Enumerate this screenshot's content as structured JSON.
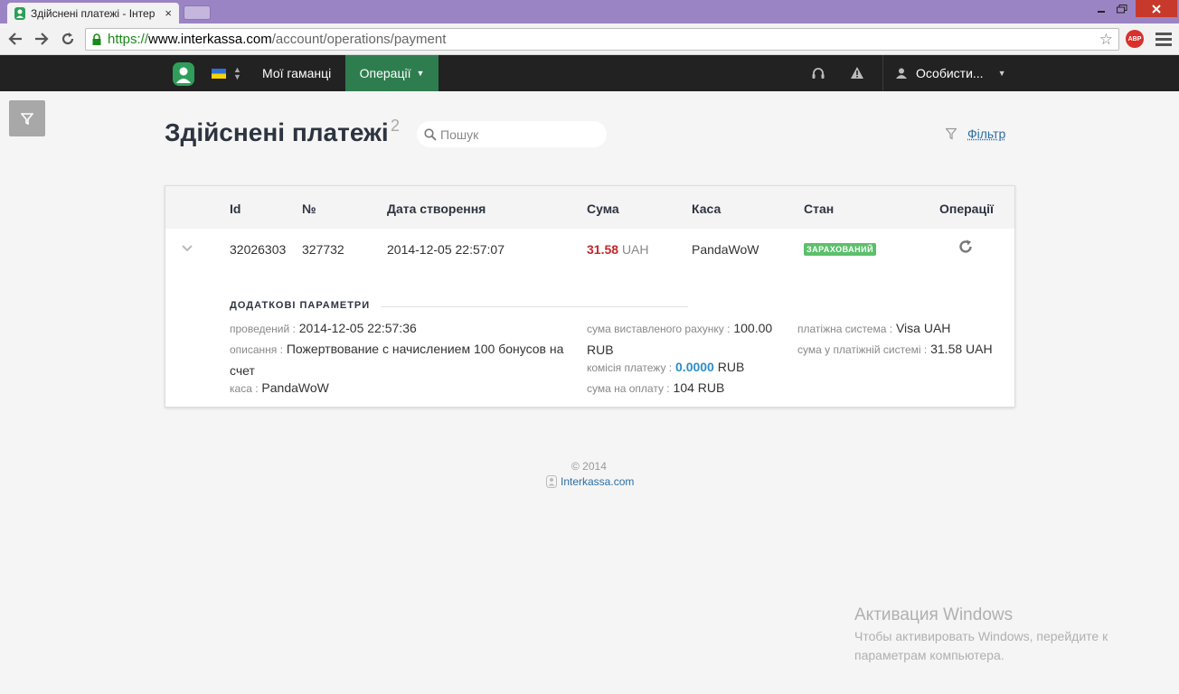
{
  "browser": {
    "tab_title": "Здійснені платежі - Інтер",
    "tab_close": "×",
    "url_scheme": "https://",
    "url_host": "www.interkassa.com",
    "url_path": "/account/operations/payment",
    "abp_label": "ABP"
  },
  "nav": {
    "wallets": "Мої гаманці",
    "operations": "Операції",
    "user": "Особисти..."
  },
  "page": {
    "title": "Здійснені платежі",
    "count": "2",
    "search_placeholder": "Пошук",
    "filter_label": "Фільтр"
  },
  "table": {
    "headers": {
      "id": "Id",
      "number": "№",
      "created": "Дата створення",
      "amount": "Сума",
      "checkout": "Каса",
      "state": "Стан",
      "operations": "Операції"
    },
    "row": {
      "id": "32026303",
      "number": "327732",
      "created": "2014-12-05 22:57:07",
      "amount": "31.58",
      "currency": "UAH",
      "checkout": "PandaWoW",
      "state": "ЗАРАХОВАНИЙ"
    }
  },
  "params": {
    "title": "ДОДАТКОВІ ПАРАМЕТРИ",
    "processed_key": "проведений :",
    "processed_val": "2014-12-05 22:57:36",
    "description_key": "описання :",
    "description_val": "Пожертвование с начислением 100 бонусов на счет",
    "checkout_key": "каса :",
    "checkout_val": "PandaWoW",
    "invoice_key": "сума виставленого рахунку :",
    "invoice_val": "100.00 RUB",
    "commission_key": "комісія платежу :",
    "commission_val": "0.0000",
    "commission_cur": "RUB",
    "payable_key": "сума на оплату :",
    "payable_val": "104 RUB",
    "system_key": "платіжна система :",
    "system_val": "Visa UAH",
    "system_amount_key": "сума у платіжній системі :",
    "system_amount_val": "31.58 UAH"
  },
  "footer": {
    "copyright": "© 2014",
    "link": "Interkassa.com"
  },
  "watermark": {
    "title": "Активация Windows",
    "text": "Чтобы активировать Windows, перейдите к параметрам компьютера."
  },
  "colors": {
    "nav_bg": "#222222",
    "nav_active": "#2e7d4f",
    "amount": "#c0282d",
    "badge": "#5bc06b",
    "link": "#2c6ea6"
  },
  "icons": [
    "favicon-icon",
    "back-icon",
    "forward-icon",
    "reload-icon",
    "lock-icon",
    "star-icon",
    "menu-icon",
    "logo-icon",
    "flag-icon",
    "headset-icon",
    "warning-icon",
    "user-icon",
    "filter-icon",
    "search-icon",
    "chevron-down-icon",
    "refresh-icon"
  ]
}
